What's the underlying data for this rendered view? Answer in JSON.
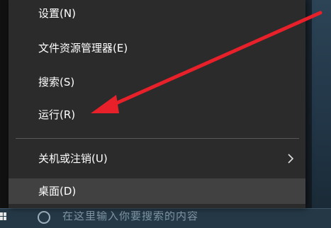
{
  "context_menu": {
    "items": [
      {
        "label": "设置(N)"
      },
      {
        "label": "文件资源管理器(E)"
      },
      {
        "label": "搜索(S)"
      },
      {
        "label": "运行(R)"
      },
      {
        "label": "关机或注销(U)",
        "has_submenu": true
      },
      {
        "label": "桌面(D)",
        "highlighted": true
      }
    ]
  },
  "taskbar": {
    "search_placeholder": "在这里输入你要搜索的内容"
  },
  "colors": {
    "menu_background": "#2b2b2b",
    "highlight": "#414141",
    "annotation_arrow": "#e8202a"
  },
  "icons": [
    "windows-logo-icon",
    "search-icon",
    "chevron-right-icon"
  ]
}
